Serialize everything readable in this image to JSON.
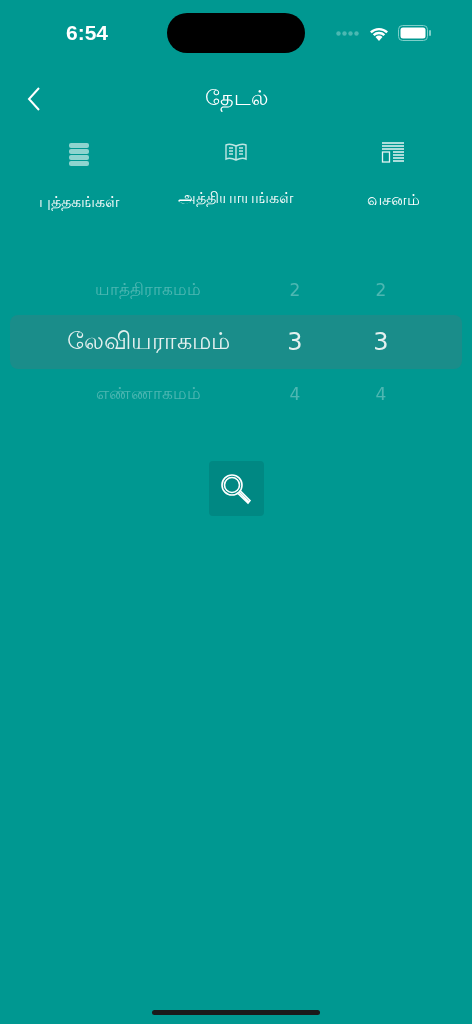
{
  "status_bar": {
    "time": "6:54"
  },
  "nav": {
    "title": "தேடல்"
  },
  "tabs": [
    {
      "label": "புத்தகங்கள்"
    },
    {
      "label": "அத்தியாயங்கள்"
    },
    {
      "label": "வசனம்"
    }
  ],
  "picker": {
    "rows": [
      {
        "book": "யாத்திராகமம்",
        "chapter": "2",
        "verse": "2",
        "selected": false
      },
      {
        "book": "லேவியராகமம்",
        "chapter": "3",
        "verse": "3",
        "selected": true
      },
      {
        "book": "எண்ணாகமம்",
        "chapter": "4",
        "verse": "4",
        "selected": false
      }
    ]
  }
}
